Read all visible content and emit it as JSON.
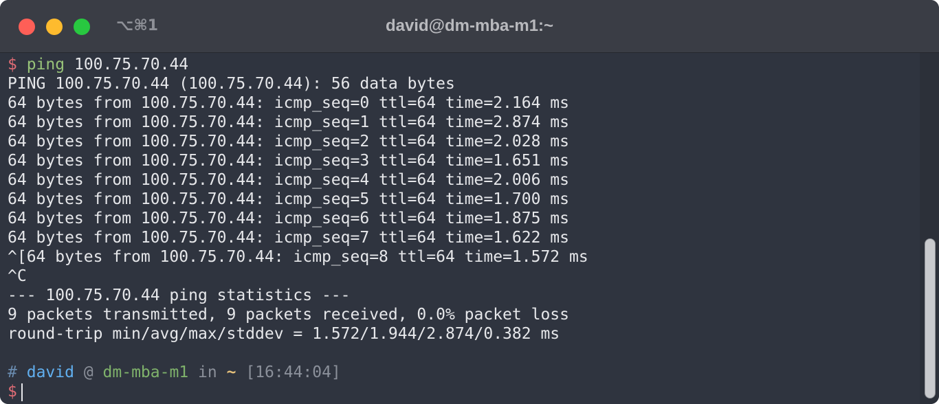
{
  "window": {
    "title": "david@dm-mba-m1:~",
    "shortcut": "⌥⌘1"
  },
  "terminal": {
    "command_prompt": "$",
    "command_name": "ping",
    "command_arg": "100.75.70.44",
    "output_lines": [
      "PING 100.75.70.44 (100.75.70.44): 56 data bytes",
      "64 bytes from 100.75.70.44: icmp_seq=0 ttl=64 time=2.164 ms",
      "64 bytes from 100.75.70.44: icmp_seq=1 ttl=64 time=2.874 ms",
      "64 bytes from 100.75.70.44: icmp_seq=2 ttl=64 time=2.028 ms",
      "64 bytes from 100.75.70.44: icmp_seq=3 ttl=64 time=1.651 ms",
      "64 bytes from 100.75.70.44: icmp_seq=4 ttl=64 time=2.006 ms",
      "64 bytes from 100.75.70.44: icmp_seq=5 ttl=64 time=1.700 ms",
      "64 bytes from 100.75.70.44: icmp_seq=6 ttl=64 time=1.875 ms",
      "64 bytes from 100.75.70.44: icmp_seq=7 ttl=64 time=1.622 ms",
      "^[64 bytes from 100.75.70.44: icmp_seq=8 ttl=64 time=1.572 ms",
      "^C",
      "--- 100.75.70.44 ping statistics ---",
      "9 packets transmitted, 9 packets received, 0.0% packet loss",
      "round-trip min/avg/max/stddev = 1.572/1.944/2.874/0.382 ms"
    ],
    "status_prompt": {
      "hash": "#",
      "user": "david",
      "at": "@",
      "host": "dm-mba-m1",
      "in": "in",
      "dir": "~",
      "time": "[16:44:04]"
    },
    "input_prompt": "$"
  },
  "scrollbar": {
    "position_fraction": 1.0
  }
}
